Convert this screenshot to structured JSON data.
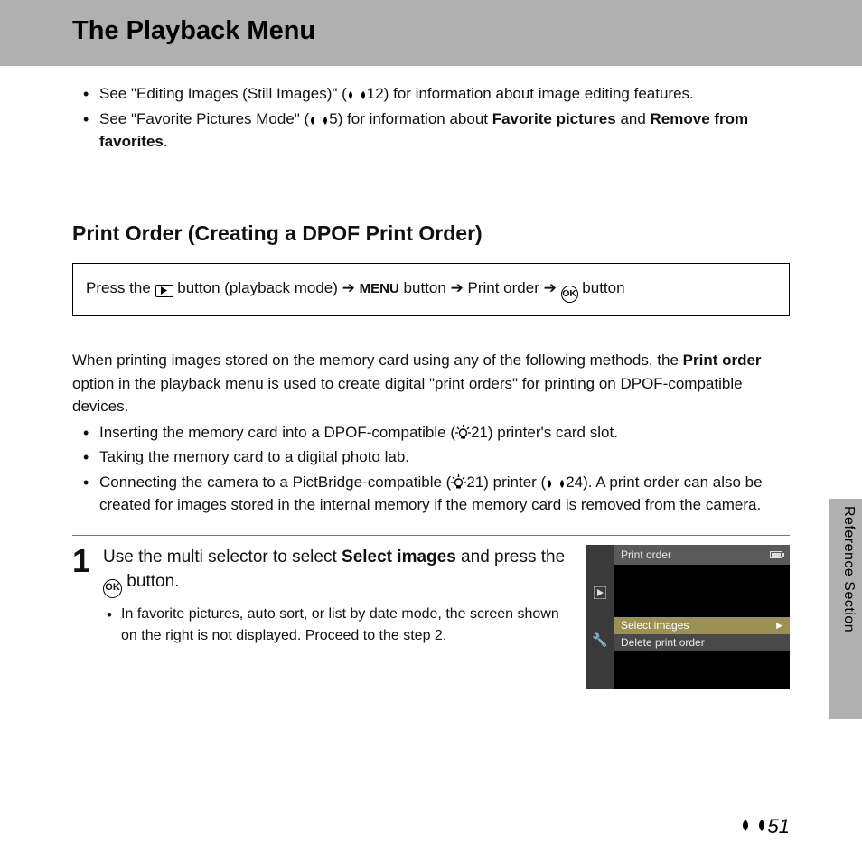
{
  "header": {
    "title": "The Playback Menu"
  },
  "intro": {
    "bullet1_a": "See \"Editing Images (Still Images)\" (",
    "bullet1_ref": "12",
    "bullet1_b": ") for information about image editing features.",
    "bullet2_a": "See \"Favorite Pictures Mode\" (",
    "bullet2_ref": "5",
    "bullet2_b": ") for information about ",
    "bullet2_bold1": "Favorite pictures",
    "bullet2_c": " and ",
    "bullet2_bold2": "Remove from favorites",
    "bullet2_d": "."
  },
  "section": {
    "title": "Print Order (Creating a DPOF Print Order)"
  },
  "navbox": {
    "press_the": "Press the ",
    "playback_mode": " button (playback mode) ",
    "menu": "MENU",
    "button_word": " button ",
    "print_order": " Print order ",
    "button_last": " button"
  },
  "body": {
    "para_a": "When printing images stored on the memory card using any of the following methods, the ",
    "para_bold": "Print order",
    "para_b": " option in the playback menu is used to create digital \"print orders\" for printing on DPOF-compatible devices.",
    "b1_a": "Inserting the memory card into a DPOF-compatible (",
    "b1_ref": "21",
    "b1_b": ") printer's card slot.",
    "b2": "Taking the memory card to a digital photo lab.",
    "b3_a": "Connecting the camera to a PictBridge-compatible (",
    "b3_ref1": "21",
    "b3_b": ") printer (",
    "b3_ref2": "24",
    "b3_c": "). A print order can also be created for images stored in the internal memory if the memory card is removed from the camera."
  },
  "step1": {
    "num": "1",
    "line_a": "Use the multi selector to select ",
    "line_bold": "Select images",
    "line_b": " and press the ",
    "line_c": " button.",
    "sub": "In favorite pictures, auto sort, or list by date mode, the screen shown on the right is not displayed. Proceed to the step 2."
  },
  "screen": {
    "title": "Print order",
    "item1": "Select images",
    "item2": "Delete print order"
  },
  "sidebar": {
    "label": "Reference Section"
  },
  "page": {
    "num": "51"
  }
}
